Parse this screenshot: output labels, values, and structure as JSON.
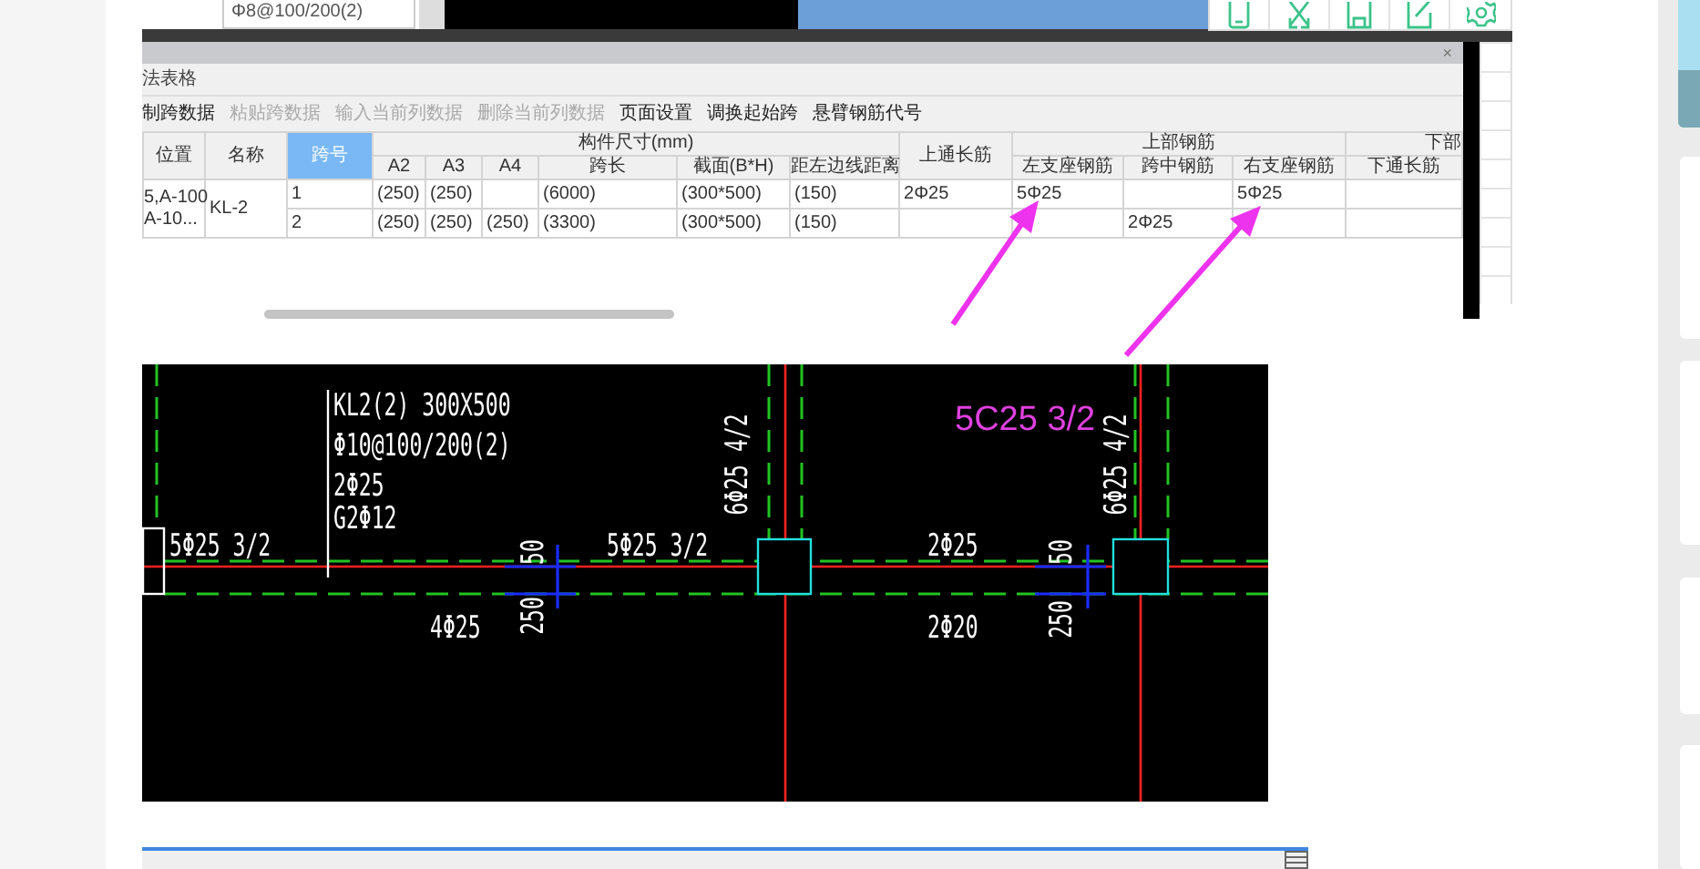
{
  "table_window": {
    "cell_fragment": "Φ8@100/200(2)",
    "close_glyph": "×",
    "title": "法表格",
    "toolbar": [
      {
        "label": "制跨数据",
        "disabled": false
      },
      {
        "label": "粘贴跨数据",
        "disabled": true
      },
      {
        "label": "输入当前列数据",
        "disabled": true
      },
      {
        "label": "删除当前列数据",
        "disabled": true
      },
      {
        "label": "页面设置",
        "disabled": false
      },
      {
        "label": "调换起始跨",
        "disabled": false
      },
      {
        "label": "悬臂钢筋代号",
        "disabled": false
      }
    ],
    "columns": [
      {
        "label": "位置",
        "selected": false
      },
      {
        "label": "名称",
        "selected": false
      },
      {
        "label": "跨号",
        "selected": true
      },
      {
        "group": "构件尺寸(mm)",
        "children": [
          "A2",
          "A3",
          "A4",
          "跨长",
          "截面(B*H)",
          "距左边线距离"
        ]
      },
      {
        "label": "上通长筋",
        "selected": false
      },
      {
        "group": "上部钢筋",
        "children": [
          "左支座钢筋",
          "跨中钢筋",
          "右支座钢筋"
        ]
      },
      {
        "group": "下部",
        "children": [
          "下通长筋"
        ]
      }
    ],
    "beam": {
      "location": [
        "5,A-100",
        "A-10..."
      ],
      "name": "KL-2",
      "spans": [
        {
          "number": "1",
          "cells": [
            "(250)",
            "(250)",
            null,
            "(6000)",
            "(300*500)",
            "(150)",
            "2Φ25",
            "5Φ25",
            null,
            "5Φ25",
            null
          ]
        },
        {
          "number": "2",
          "cells": [
            "(250)",
            "(250)",
            "(250)",
            "(3300)",
            "(300*500)",
            "(150)",
            null,
            null,
            "2Φ25",
            null,
            null
          ]
        }
      ]
    }
  },
  "cad_drawing": {
    "labels": [
      "KL2(2) 300X500",
      "Φ10@100/200(2)",
      "2Φ25",
      "G2Φ12",
      "5Φ25 3/2",
      "6Φ25 4/2",
      "6Φ25 4/2",
      "5Φ25 3/2",
      "50",
      "2Φ25",
      "50",
      "4Φ25",
      "250",
      "2Φ20",
      "250"
    ],
    "annotation": "5C25 3/2"
  }
}
